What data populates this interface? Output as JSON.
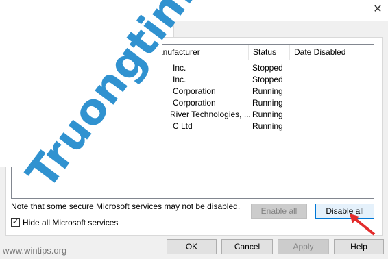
{
  "window": {
    "close_glyph": "✕"
  },
  "list": {
    "columns": [
      "Manufacturer",
      "Status",
      "Date Disabled"
    ],
    "rows": [
      {
        "manufacturer": "Inc.",
        "status": "Stopped",
        "date": ""
      },
      {
        "manufacturer": "Inc.",
        "status": "Stopped",
        "date": ""
      },
      {
        "manufacturer": "Corporation",
        "status": "Running",
        "date": ""
      },
      {
        "manufacturer": "Corporation",
        "status": "Running",
        "date": ""
      },
      {
        "manufacturer": "River Technologies, ...",
        "status": "Running",
        "date": ""
      },
      {
        "manufacturer": "C Ltd",
        "status": "Running",
        "date": ""
      }
    ]
  },
  "note": "Note that some secure Microsoft services may not be disabled.",
  "buttons": {
    "enable_all": "Enable all",
    "disable_all": "Disable all",
    "ok": "OK",
    "cancel": "Cancel",
    "apply": "Apply",
    "help": "Help"
  },
  "hide_ms": {
    "label": "Hide all Microsoft services",
    "checked": true,
    "mark": "✓"
  },
  "watermark": {
    "text": "Truongtin.top",
    "site": "www.wintips.org"
  },
  "colors": {
    "watermark": "#2a8fcf",
    "arrow": "#e32b2b",
    "focus": "#0078d7"
  }
}
